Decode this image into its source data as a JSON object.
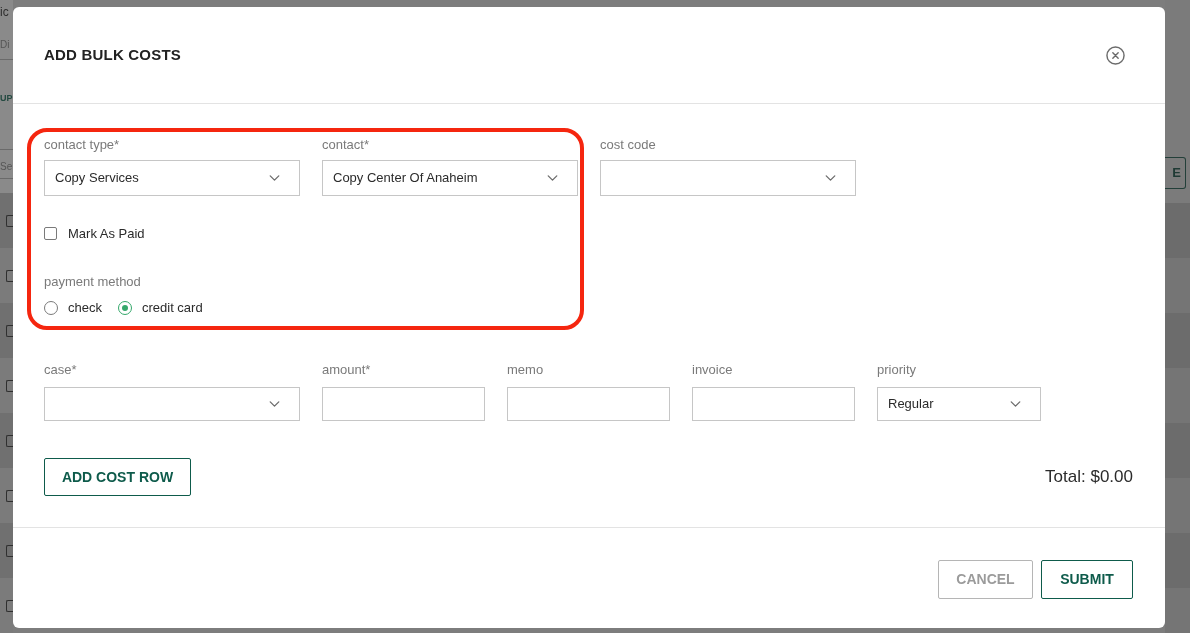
{
  "background_page": {
    "left_edge_texts": [
      {
        "kind": "heading",
        "text": "ic"
      },
      {
        "kind": "placeholder",
        "text": "Di"
      },
      {
        "kind": "tab",
        "text": "UP"
      },
      {
        "kind": "placeholder",
        "text": "Se"
      }
    ],
    "row_checkboxes": [
      {
        "checked": false
      },
      {
        "checked": false
      },
      {
        "checked": false
      },
      {
        "checked": false
      },
      {
        "checked": false
      },
      {
        "checked": false
      },
      {
        "checked": false
      },
      {
        "checked": false
      }
    ],
    "right_edge_button": "E"
  },
  "dialog": {
    "title": "ADD BULK COSTS",
    "contact_fields": [
      {
        "kind": "select",
        "label": "contact type*",
        "value": "Copy Services"
      },
      {
        "kind": "select",
        "label": "contact*",
        "value": "Copy Center Of Anaheim"
      }
    ],
    "cost_code": {
      "kind": "select",
      "label": "cost code"
    },
    "mark_as_paid": {
      "label": "Mark As Paid",
      "checked": false
    },
    "payment_method": {
      "label": "payment method",
      "options": [
        {
          "label": "check",
          "selected": false
        },
        {
          "label": "credit card",
          "selected": true
        }
      ]
    },
    "cost_row": [
      {
        "kind": "select",
        "label": "case*"
      },
      {
        "kind": "input",
        "label": "amount*"
      },
      {
        "kind": "input",
        "label": "memo"
      },
      {
        "kind": "input",
        "label": "invoice"
      },
      {
        "kind": "select",
        "label": "priority",
        "value": "Regular"
      }
    ],
    "add_row_button": "ADD COST ROW",
    "total": "Total: $0.00",
    "buttons": [
      {
        "kind": "secondary",
        "label": "CANCEL"
      },
      {
        "kind": "primary",
        "label": "SUBMIT"
      }
    ]
  }
}
